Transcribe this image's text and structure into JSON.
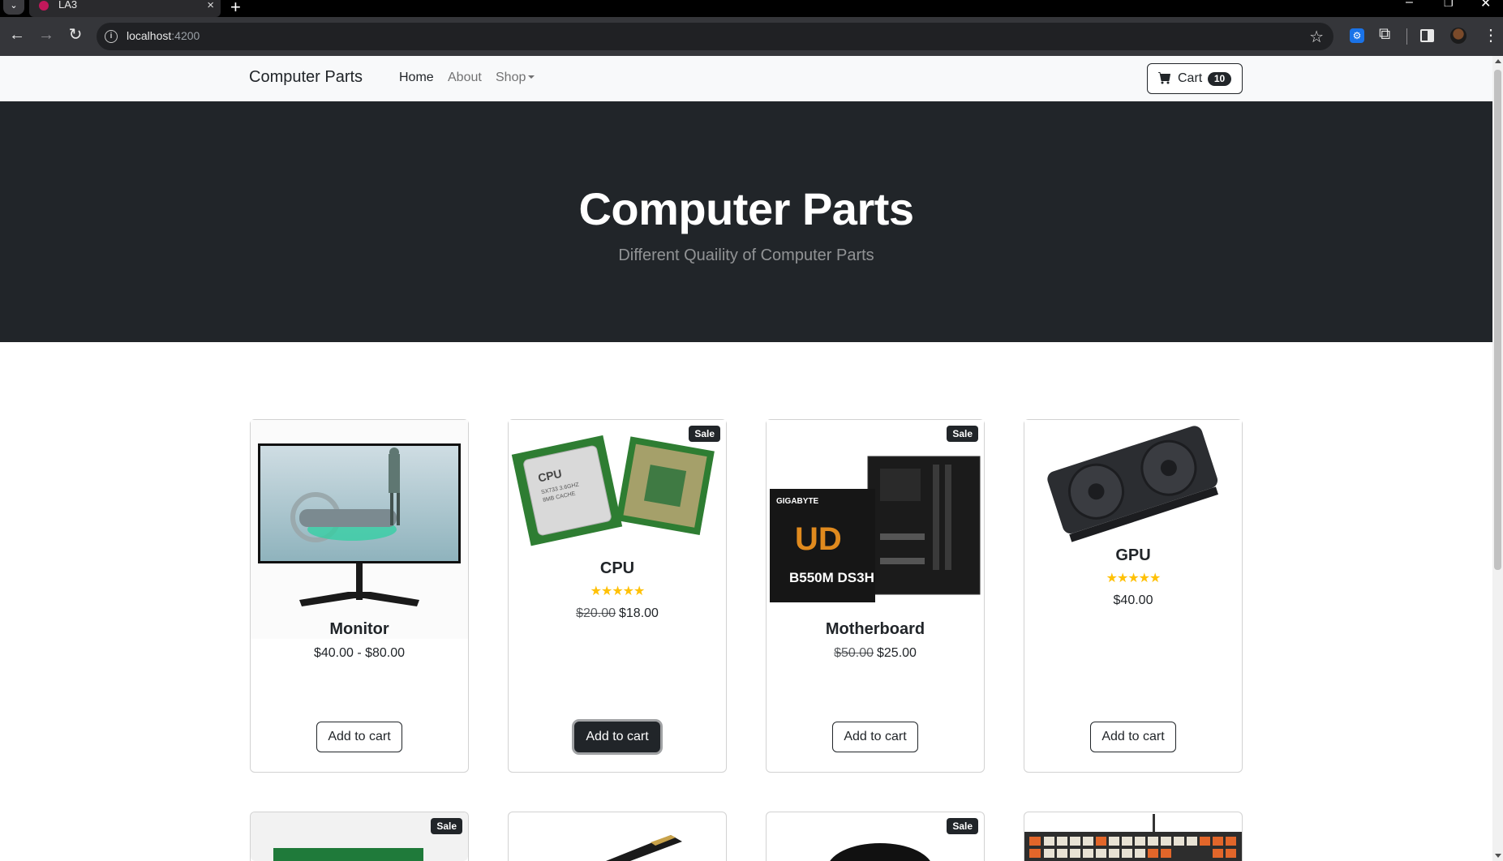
{
  "browser": {
    "tab_title": "LA3",
    "url_host": "localhost",
    "url_port": ":4200"
  },
  "navbar": {
    "brand": "Computer Parts",
    "links": [
      "Home",
      "About",
      "Shop"
    ],
    "cart_label": "Cart",
    "cart_count": "10"
  },
  "hero": {
    "title": "Computer Parts",
    "subtitle": "Different Quaility of Computer Parts"
  },
  "products": [
    {
      "name": "Monitor",
      "sale": false,
      "rating": 0,
      "price": "$40.00 - $80.00",
      "button": "Add to cart"
    },
    {
      "name": "CPU",
      "sale": true,
      "sale_label": "Sale",
      "rating": 5,
      "old_price": "$20.00",
      "price": "$18.00",
      "button": "Add to cart",
      "button_hovered": true
    },
    {
      "name": "Motherboard",
      "sale": true,
      "sale_label": "Sale",
      "rating": 0,
      "old_price": "$50.00",
      "price": "$25.00",
      "button": "Add to cart"
    },
    {
      "name": "GPU",
      "sale": false,
      "rating": 5,
      "price": "$40.00",
      "button": "Add to cart"
    }
  ],
  "products_row2": [
    {
      "sale_label": "Sale"
    },
    {},
    {
      "sale_label": "Sale"
    },
    {}
  ],
  "colors": {
    "dark": "#212529",
    "star": "#ffc107",
    "navbar_bg": "#f8f9fa"
  }
}
